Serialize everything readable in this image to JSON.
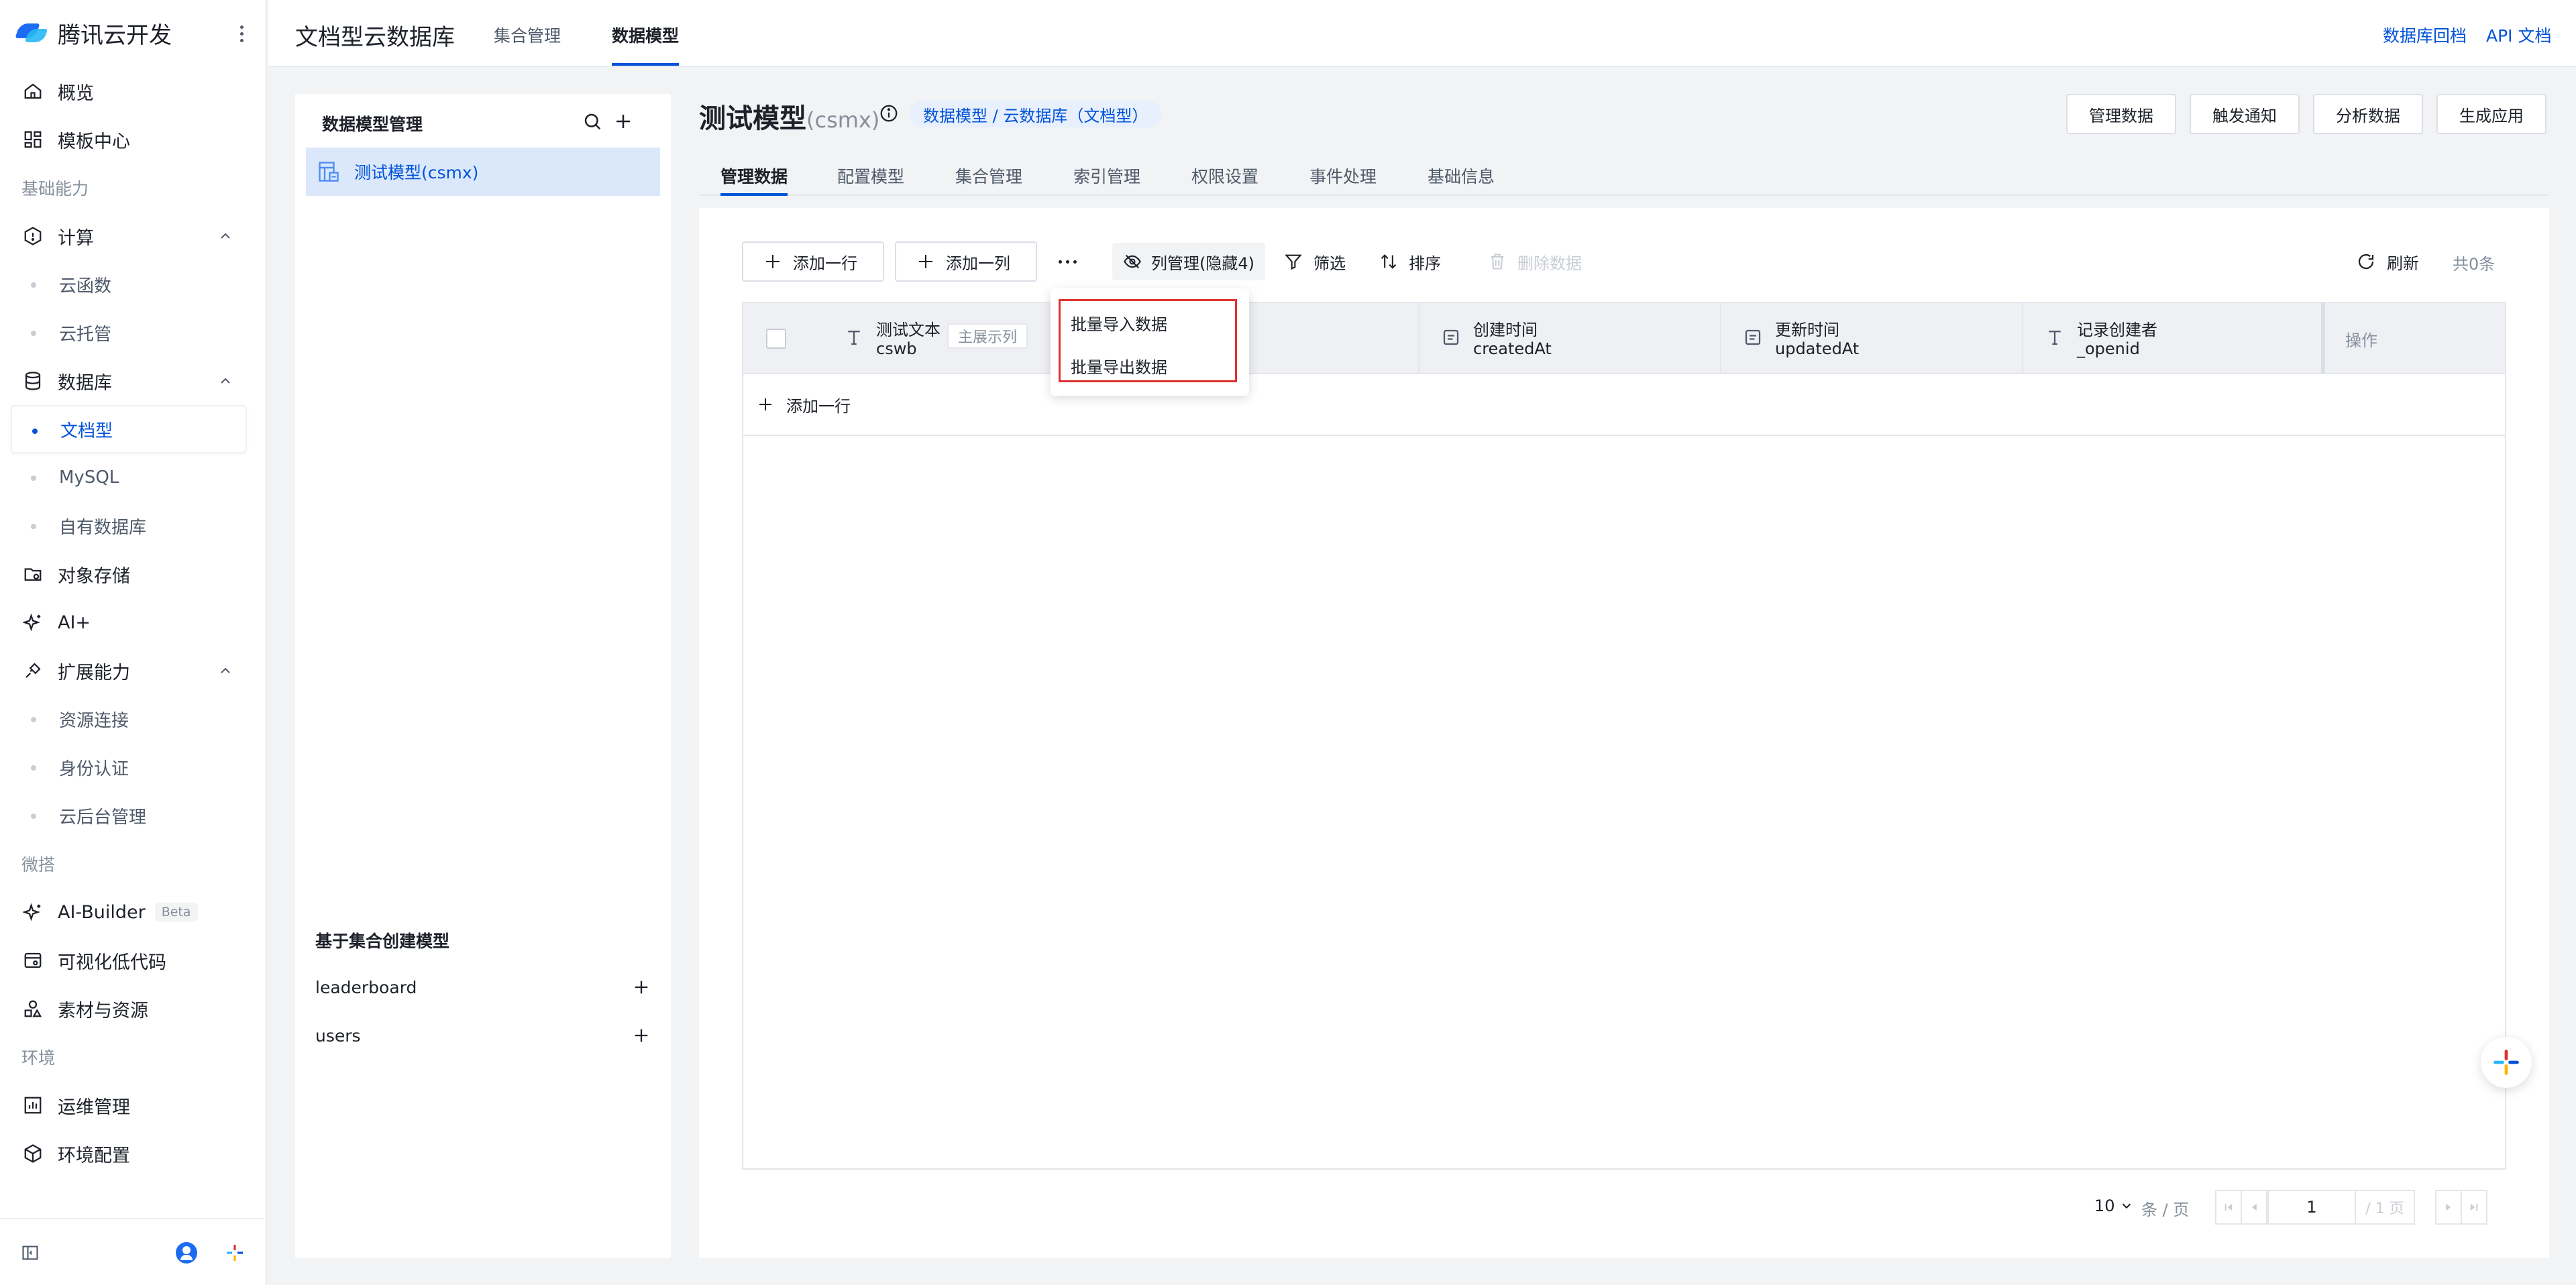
{
  "app": {
    "brand_title": "腾讯云开发"
  },
  "sidebar": {
    "items": [
      {
        "type": "item",
        "label": "概览",
        "icon": "home-icon"
      },
      {
        "type": "item",
        "label": "模板中心",
        "icon": "grid-icon"
      },
      {
        "type": "group",
        "label": "基础能力"
      },
      {
        "type": "item",
        "label": "计算",
        "icon": "hexagon-icon",
        "expanded": true
      },
      {
        "type": "sub",
        "label": "云函数"
      },
      {
        "type": "sub",
        "label": "云托管"
      },
      {
        "type": "item",
        "label": "数据库",
        "icon": "database-icon",
        "expanded": true
      },
      {
        "type": "sub",
        "label": "文档型",
        "active": true
      },
      {
        "type": "sub",
        "label": "MySQL"
      },
      {
        "type": "sub",
        "label": "自有数据库"
      },
      {
        "type": "item",
        "label": "对象存储",
        "icon": "folder-icon"
      },
      {
        "type": "item",
        "label": "AI+",
        "icon": "sparkle-icon"
      },
      {
        "type": "item",
        "label": "扩展能力",
        "icon": "plug-icon",
        "expanded": true
      },
      {
        "type": "sub",
        "label": "资源连接"
      },
      {
        "type": "sub",
        "label": "身份认证"
      },
      {
        "type": "sub",
        "label": "云后台管理"
      },
      {
        "type": "group",
        "label": "微搭"
      },
      {
        "type": "item",
        "label": "AI-Builder",
        "icon": "sparkle-icon",
        "badge": "Beta"
      },
      {
        "type": "item",
        "label": "可视化低代码",
        "icon": "code-icon"
      },
      {
        "type": "item",
        "label": "素材与资源",
        "icon": "assets-icon"
      },
      {
        "type": "group",
        "label": "环境"
      },
      {
        "type": "item",
        "label": "运维管理",
        "icon": "chart-icon"
      },
      {
        "type": "item",
        "label": "环境配置",
        "icon": "cube-icon"
      }
    ]
  },
  "header": {
    "title": "文档型云数据库",
    "tabs": [
      "集合管理",
      "数据模型"
    ],
    "active_tab": "数据模型",
    "links": [
      "数据库回档",
      "API 文档"
    ]
  },
  "model_panel": {
    "title": "数据模型管理",
    "models": [
      "测试模型(csmx)"
    ],
    "section_title": "基于集合创建模型",
    "collections": [
      "leaderboard",
      "users"
    ]
  },
  "main": {
    "title": "测试模型",
    "title_sub": "(csmx)",
    "breadcrumb_badge": "数据模型 / 云数据库（文档型）",
    "actions": [
      "管理数据",
      "触发通知",
      "分析数据",
      "生成应用"
    ],
    "tabs": [
      "管理数据",
      "配置模型",
      "集合管理",
      "索引管理",
      "权限设置",
      "事件处理",
      "基础信息"
    ],
    "active_tab": "管理数据"
  },
  "toolbar": {
    "add_row": "添加一行",
    "add_col": "添加一列",
    "col_mgr": "列管理(隐藏4)",
    "filter": "筛选",
    "sort": "排序",
    "delete": "删除数据",
    "refresh": "刷新",
    "total": "共0条"
  },
  "dropdown": {
    "items": [
      "批量导入数据",
      "批量导出数据"
    ]
  },
  "table": {
    "columns": [
      {
        "name": "测试文本",
        "key": "cswb",
        "tag": "主展示列",
        "icon": "text-type-icon"
      },
      {
        "name": "创建时间",
        "key": "createdAt",
        "icon": "date-type-icon"
      },
      {
        "name": "更新时间",
        "key": "updatedAt",
        "icon": "date-type-icon"
      },
      {
        "name": "记录创建者",
        "key": "_openid",
        "icon": "text-type-icon"
      }
    ],
    "ops_label": "操作",
    "add_row": "添加一行"
  },
  "pagination": {
    "page_size": "10",
    "unit": "条 / 页",
    "page": "1",
    "total_pages": "/ 1 页"
  },
  "colors": {
    "accent": "#0052d9",
    "highlight_border": "#e0312f",
    "active_bg": "#dbe8fc"
  }
}
